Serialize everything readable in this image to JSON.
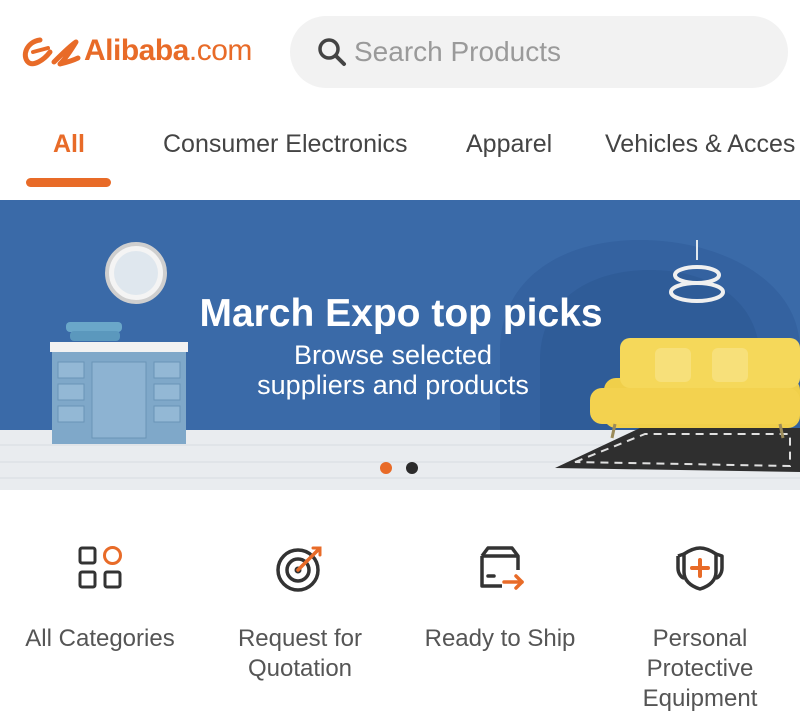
{
  "header": {
    "logo_text": "Alibaba",
    "logo_suffix": ".com",
    "search_placeholder": "Search Products",
    "search_icon": "search-icon"
  },
  "tabs": [
    {
      "label": "All",
      "active": true
    },
    {
      "label": "Consumer Electronics",
      "active": false
    },
    {
      "label": "Apparel",
      "active": false
    },
    {
      "label": "Vehicles & Acces",
      "active": false
    }
  ],
  "banner": {
    "title": "March Expo top picks",
    "subtitle_line1": "Browse selected",
    "subtitle_line2": "suppliers and products",
    "slide_count": 2,
    "active_slide": 1
  },
  "actions": [
    {
      "label": "All Categories",
      "icon": "categories-grid-icon"
    },
    {
      "label": "Request for Quotation",
      "icon": "target-icon"
    },
    {
      "label": "Ready to Ship",
      "icon": "shipping-box-icon"
    },
    {
      "label": "Personal Protective Equipment",
      "icon": "shield-plus-icon"
    }
  ],
  "colors": {
    "accent": "#e86b28",
    "banner_blue": "#3a6aa8",
    "text": "#555555",
    "search_bg": "#f2f2f2"
  }
}
